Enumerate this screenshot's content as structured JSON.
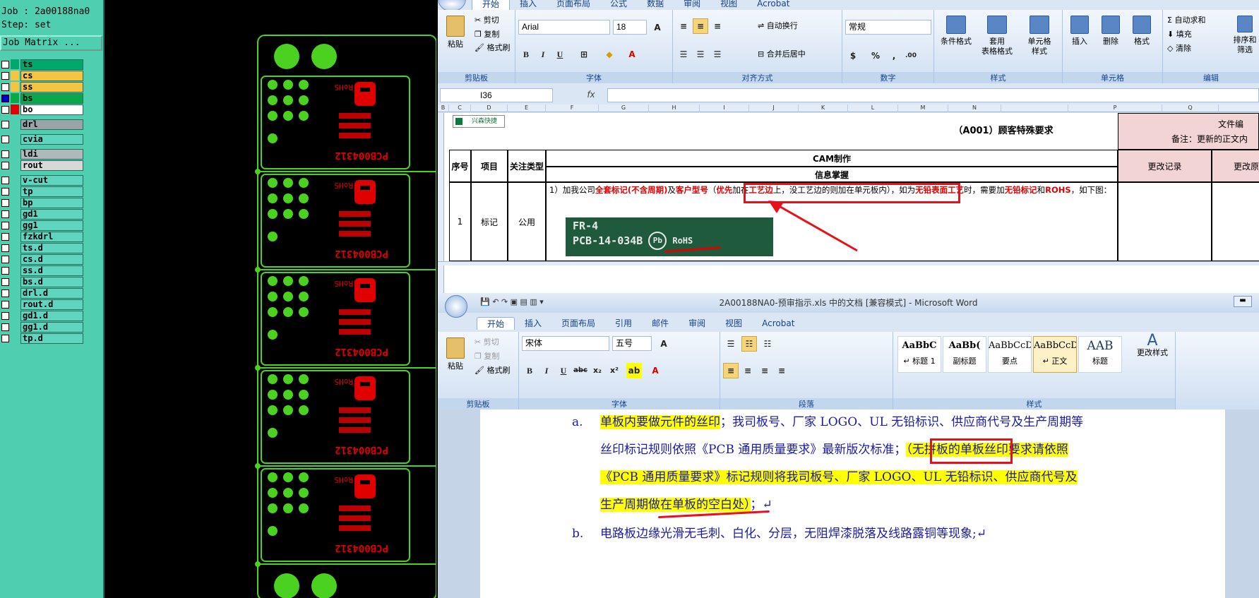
{
  "cam": {
    "job_label": "Job : 2a00188na0",
    "step_label": "Step: set",
    "job_matrix": "Job Matrix ...",
    "layers": [
      {
        "name": "ts",
        "color": "#00a86b"
      },
      {
        "name": "cs",
        "color": "#f5c542"
      },
      {
        "name": "ss",
        "color": "#f5c542"
      },
      {
        "name": "bs",
        "color": "#0aa84a"
      },
      {
        "name": "bo",
        "color": "#e00000"
      },
      {
        "name": "drl",
        "color": "#9aa4a8"
      },
      {
        "name": "cvia",
        "color": "#5fd5c0"
      },
      {
        "name": "ldi",
        "color": "#b0b8bc"
      },
      {
        "name": "rout",
        "color": "#d8d8d8"
      },
      {
        "name": "v-cut",
        "color": "#5fd5c0"
      },
      {
        "name": "tp",
        "color": "#5fd5c0"
      },
      {
        "name": "bp",
        "color": "#5fd5c0"
      },
      {
        "name": "gd1",
        "color": "#5fd5c0"
      },
      {
        "name": "gg1",
        "color": "#5fd5c0"
      },
      {
        "name": "fzkdrl",
        "color": "#5fd5c0"
      },
      {
        "name": "ts.d",
        "color": "#5fd5c0"
      },
      {
        "name": "cs.d",
        "color": "#5fd5c0"
      },
      {
        "name": "ss.d",
        "color": "#5fd5c0"
      },
      {
        "name": "bs.d",
        "color": "#5fd5c0"
      },
      {
        "name": "drl.d",
        "color": "#5fd5c0"
      },
      {
        "name": "rout.d",
        "color": "#5fd5c0"
      },
      {
        "name": "gd1.d",
        "color": "#5fd5c0"
      },
      {
        "name": "gg1.d",
        "color": "#5fd5c0"
      },
      {
        "name": "tp.d",
        "color": "#5fd5c0"
      }
    ],
    "board_marking": {
      "code": "PCB004312",
      "rohs": "RoHS"
    }
  },
  "excel": {
    "tabs": [
      "开始",
      "插入",
      "页面布局",
      "公式",
      "数据",
      "审阅",
      "视图",
      "Acrobat"
    ],
    "groups": {
      "clipboard": "剪贴板",
      "font": "字体",
      "align": "对齐方式",
      "number": "数字",
      "style": "样式",
      "cells": "单元格",
      "edit": "编辑"
    },
    "buttons": {
      "paste": "粘贴",
      "cut": "剪切",
      "copy": "复制",
      "format_painter": "格式刷",
      "wrap": "自动换行",
      "merge": "合并后居中",
      "cond_format": "条件格式",
      "table_format": "套用\n表格格式",
      "cell_style": "单元格\n样式",
      "insert": "插入",
      "delete": "删除",
      "format": "格式",
      "autosum": "自动求和",
      "fill": "填充",
      "clear": "清除",
      "sort": "排序和\n筛选"
    },
    "font_name": "Arial",
    "font_size": "18",
    "number_format": "常规",
    "name_box": "I36",
    "fx": "fx",
    "col_headers": [
      "B",
      "C",
      "D",
      "E",
      "F",
      "G",
      "H",
      "I",
      "J",
      "K",
      "L",
      "M",
      "N",
      "",
      "P",
      "Q"
    ],
    "sheet": {
      "logo_text": "兴森快捷",
      "title": "（A001）顾客特殊要求",
      "file_label": "文件编",
      "note": "备注：更新的正文内",
      "h_seq": "序号",
      "h_item": "项目",
      "h_type": "关注类型",
      "h_cam": "CAM制作",
      "h_info": "信息掌握",
      "h_change": "更改记录",
      "h_reason": "更改原",
      "row_seq": "1",
      "row_item": "标记",
      "row_type": "公用",
      "req_1": "1）加我公司",
      "req_2": "全套标记(不含周期)",
      "req_3": "及",
      "req_4": "客户型号",
      "req_5": "（",
      "req_6": "优先",
      "req_7": "加在",
      "req_8": "工艺边",
      "req_9": "上，没工艺边的则加在单元板内）",
      "req_10": "，如为",
      "req_11": "无铅表面工艺",
      "req_12": "时，需要加",
      "req_13": "无铅",
      "req_14": "标记",
      "req_15": "和",
      "req_16": "ROHS",
      "req_17": "，如下图：",
      "img_line1": "FR-4",
      "img_line2": "PCB-14-034B",
      "img_pb": "Pb",
      "img_rohs": "RoHS"
    }
  },
  "word": {
    "title": "2A00188NA0-预审指示.xls 中的文档 [兼容模式] - Microsoft Word",
    "tabs": [
      "开始",
      "插入",
      "页面布局",
      "引用",
      "邮件",
      "审阅",
      "视图",
      "Acrobat"
    ],
    "groups": {
      "clipboard": "剪贴板",
      "font": "字体",
      "para": "段落",
      "style": "样式"
    },
    "buttons": {
      "paste": "粘贴",
      "cut": "剪切",
      "copy": "复制",
      "format_painter": "格式刷",
      "change_style": "更改样式"
    },
    "font_name": "宋体",
    "font_size": "五号",
    "styles": [
      {
        "preview": "AaBbC",
        "label": "↵ 标题 1"
      },
      {
        "preview": "AaBb(",
        "label": "副标题"
      },
      {
        "preview": "AaBbCcD",
        "label": "要点"
      },
      {
        "preview": "AaBbCcD(",
        "label": "↵ 正文"
      },
      {
        "preview": "AAB",
        "label": "标题"
      }
    ],
    "doc": {
      "a_marker": "a.",
      "a1_hl": "单板内要做元件的丝印",
      "a1_rest": "；我司板号、厂家 LOGO、UL 无铅标识、供应商代号及生产周期等",
      "a2_plain": "丝印标记规则依照《PCB 通用质量要求》最新版次标准；",
      "a2_hl": "（无拼板的单板丝印要求请依照",
      "a3": "《PCB 通用质量要求》标记规则将我司板号、厂家 LOGO、UL 无铅标识、供应商代号及",
      "a4": "生产周期做在单板的空白处）",
      "a4_end": "；↵",
      "b_marker": "b.",
      "b1": "电路板边缘光滑无毛刺、白化、分层，无阻焊漆脱落及线路露铜等现象;↵"
    }
  }
}
